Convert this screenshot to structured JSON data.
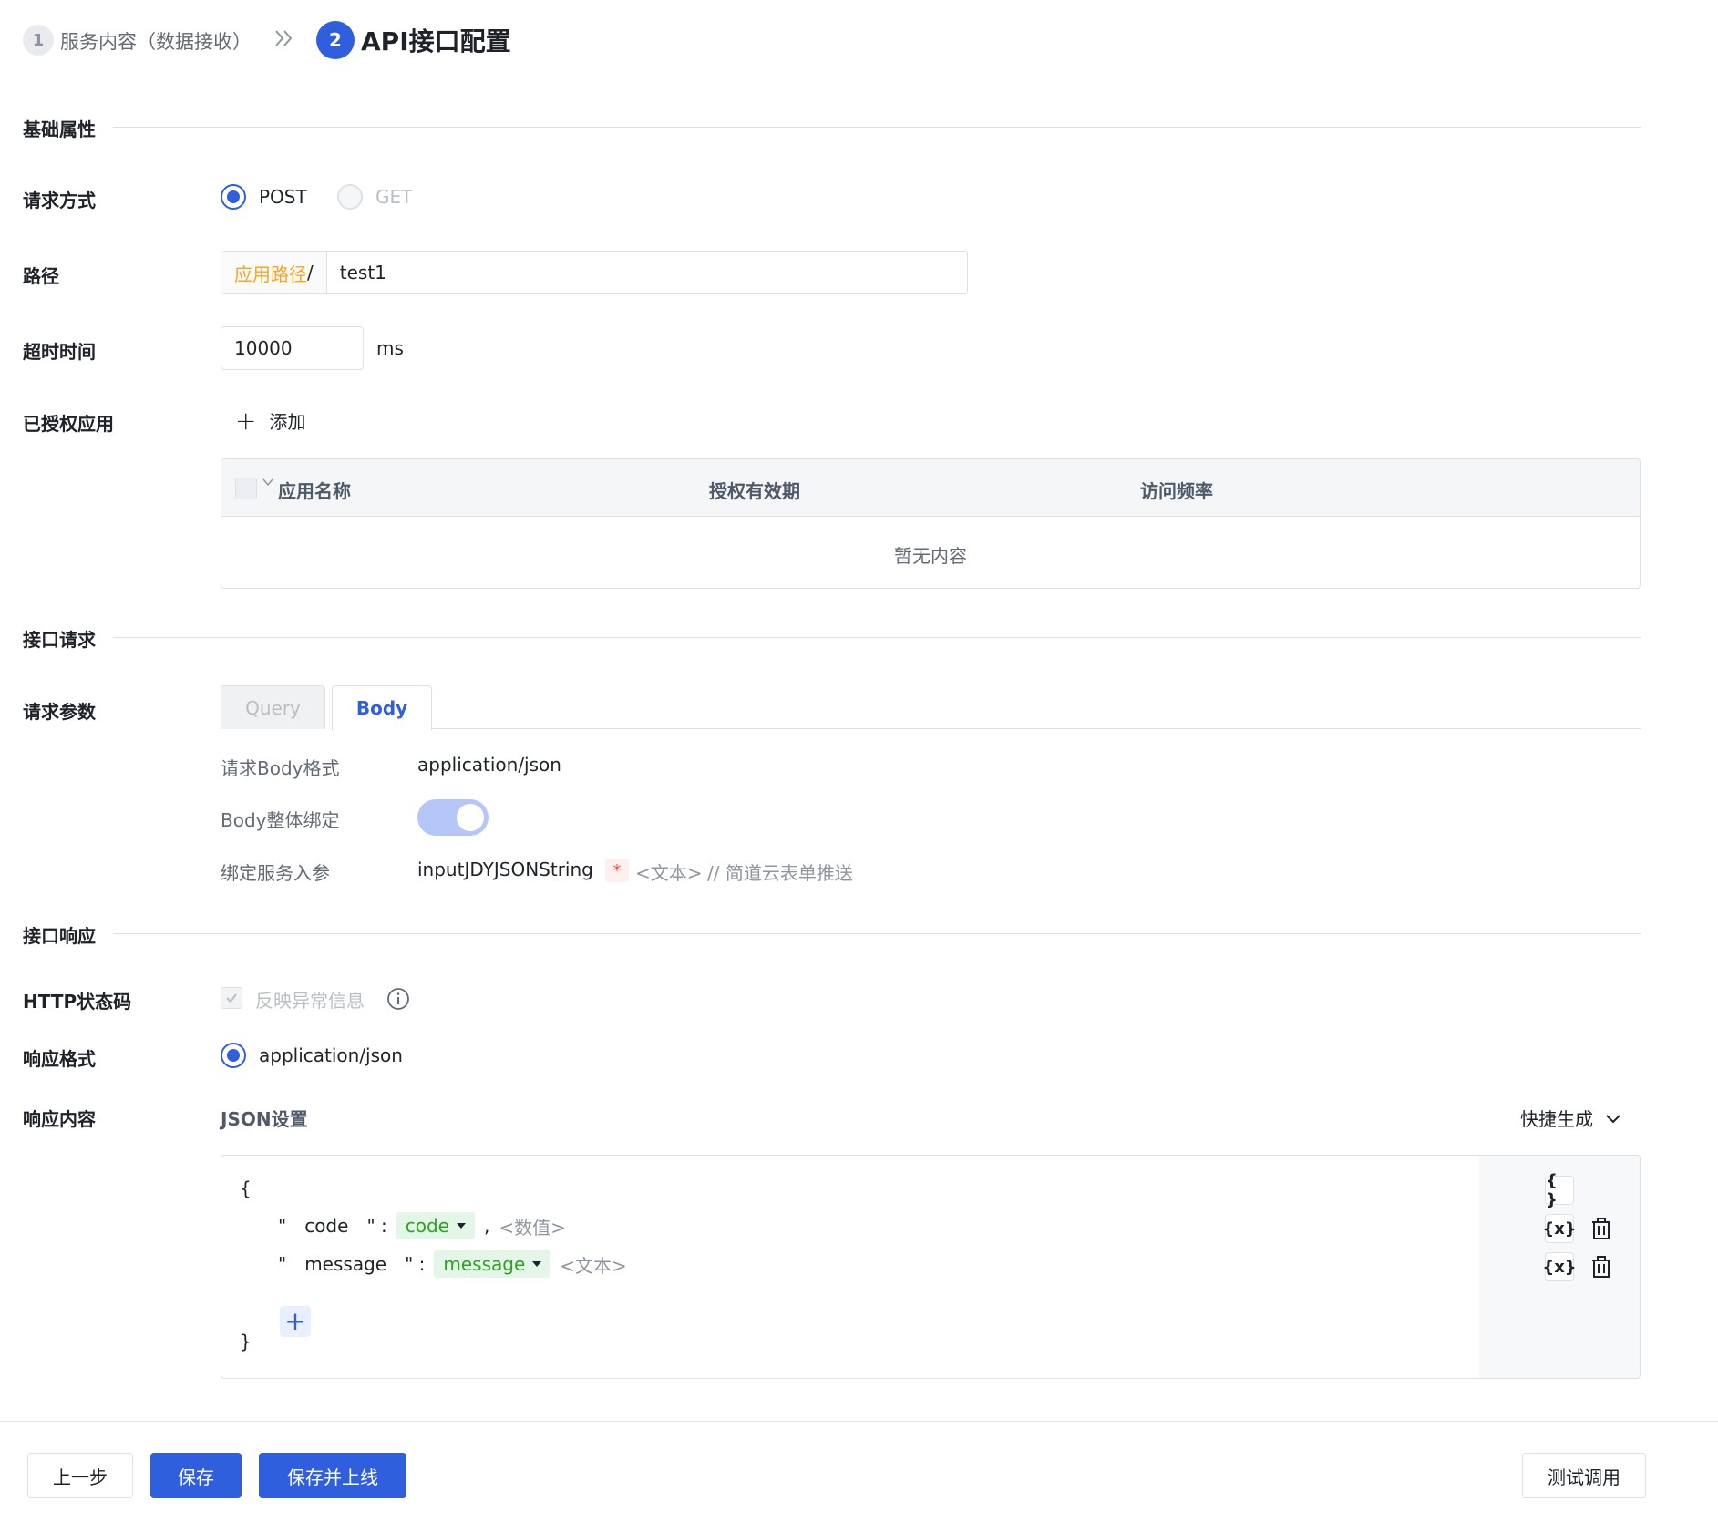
{
  "steps": {
    "step1": {
      "number": "1",
      "label": "服务内容（数据接收）"
    },
    "step2": {
      "number": "2",
      "label": "API接口配置"
    }
  },
  "sections": {
    "basic": "基础属性",
    "request": "接口请求",
    "response": "接口响应"
  },
  "basic": {
    "method_label": "请求方式",
    "method_options": [
      "POST",
      "GET"
    ],
    "method_selected": "POST",
    "path_label": "路径",
    "path_prefix": "应用路径",
    "path_slash": "/",
    "path_value": "test1",
    "timeout_label": "超时时间",
    "timeout_value": "10000",
    "timeout_unit": "ms",
    "auth_label": "已授权应用",
    "add_label": "添加",
    "table": {
      "columns": [
        "应用名称",
        "授权有效期",
        "访问频率"
      ],
      "empty_text": "暂无内容"
    }
  },
  "request": {
    "params_label": "请求参数",
    "tabs": [
      "Query",
      "Body"
    ],
    "active_tab": "Body",
    "body_format_label": "请求Body格式",
    "body_format_value": "application/json",
    "body_bind_label": "Body整体绑定",
    "body_bind_on": true,
    "bind_param_label": "绑定服务入参",
    "bind_param_name": "inputJDYJSONString",
    "bind_param_required": "*",
    "bind_param_type": "<文本>",
    "bind_param_comment": "// 简道云表单推送"
  },
  "response": {
    "http_status_label": "HTTP状态码",
    "http_status_checkbox": "反映异常信息",
    "format_label": "响应格式",
    "format_value": "application/json",
    "content_label": "响应内容",
    "json_settings": "JSON设置",
    "quick_gen": "快捷生成",
    "json": {
      "open": "{",
      "close": "}",
      "fields": [
        {
          "key": "code",
          "value": "code",
          "comma": ",",
          "type": "<数值>"
        },
        {
          "key": "message",
          "value": "message",
          "comma": "",
          "type": "<文本>"
        }
      ],
      "add": "+"
    },
    "side_icons": {
      "object": "{ }",
      "var": "{x}"
    }
  },
  "footer": {
    "prev": "上一步",
    "save": "保存",
    "save_online": "保存并上线",
    "test": "测试调用"
  },
  "colors": {
    "primary": "#2f5fdd",
    "accent_orange": "#f5a623",
    "tag_green": "#2ea121"
  }
}
